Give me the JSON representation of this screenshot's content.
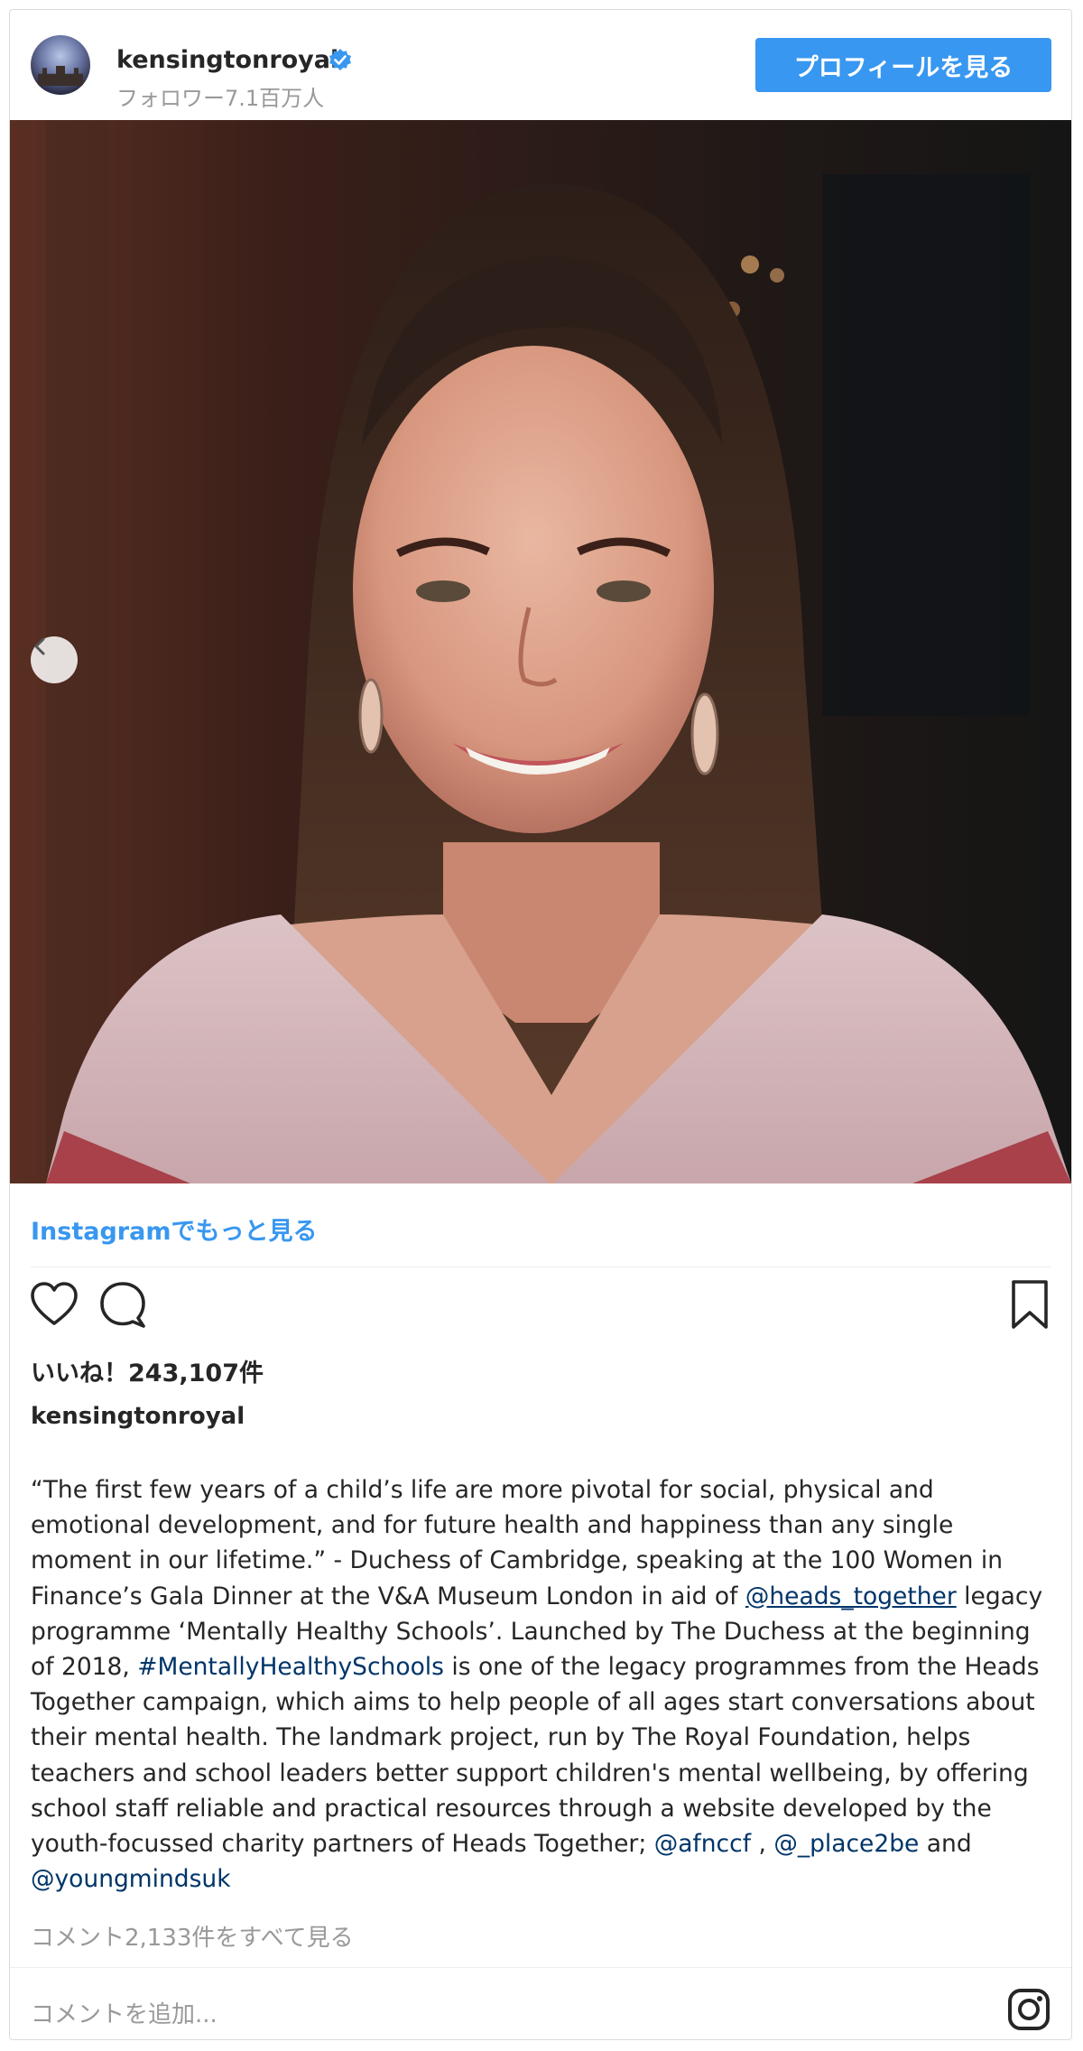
{
  "header": {
    "username": "kensingtonroyal",
    "followers": "フォロワー7.1百万人",
    "profile_button": "プロフィールを見る"
  },
  "more_link": "Instagramでもっと見る",
  "likes": "いいね！243,107件",
  "caption": {
    "username": "kensingtonroyal",
    "part1": "“The first few years of a child’s life are more pivotal for social, physical and emotional development, and for future health and happiness than any single moment in our lifetime.” - Duchess of Cambridge, speaking at the 100 Women in Finance’s Gala Dinner at the V&A Museum London in aid of ",
    "mention1": "@heads_together",
    "part2": " legacy programme ‘Mentally Healthy Schools’. Launched by The Duchess at the beginning of 2018, ",
    "hashtag": "#MentallyHealthySchools",
    "part3": " is one of the legacy programmes from the Heads Together campaign, which aims to help people of all ages start conversations about their mental health. The landmark project, run by The Royal Foundation, helps teachers and school leaders better support children's mental wellbeing, by offering school staff reliable and practical resources through a website developed by the youth-focussed charity partners of Heads Together; ",
    "mention2": "@afnccf",
    "part4": " , ",
    "mention3": "@_place2be",
    "part5": " and ",
    "mention4": "@youngmindsuk"
  },
  "view_comments": "コメント2,133件をすべて見る",
  "add_comment_placeholder": "コメントを追加...",
  "icons": {
    "verified": "verified-badge-icon",
    "prev": "chevron-left-icon",
    "like": "heart-icon",
    "comment": "comment-icon",
    "save": "bookmark-icon",
    "brand": "instagram-icon"
  },
  "colors": {
    "accent": "#3897f0",
    "link": "#003569",
    "muted": "#999999",
    "text": "#262626"
  }
}
